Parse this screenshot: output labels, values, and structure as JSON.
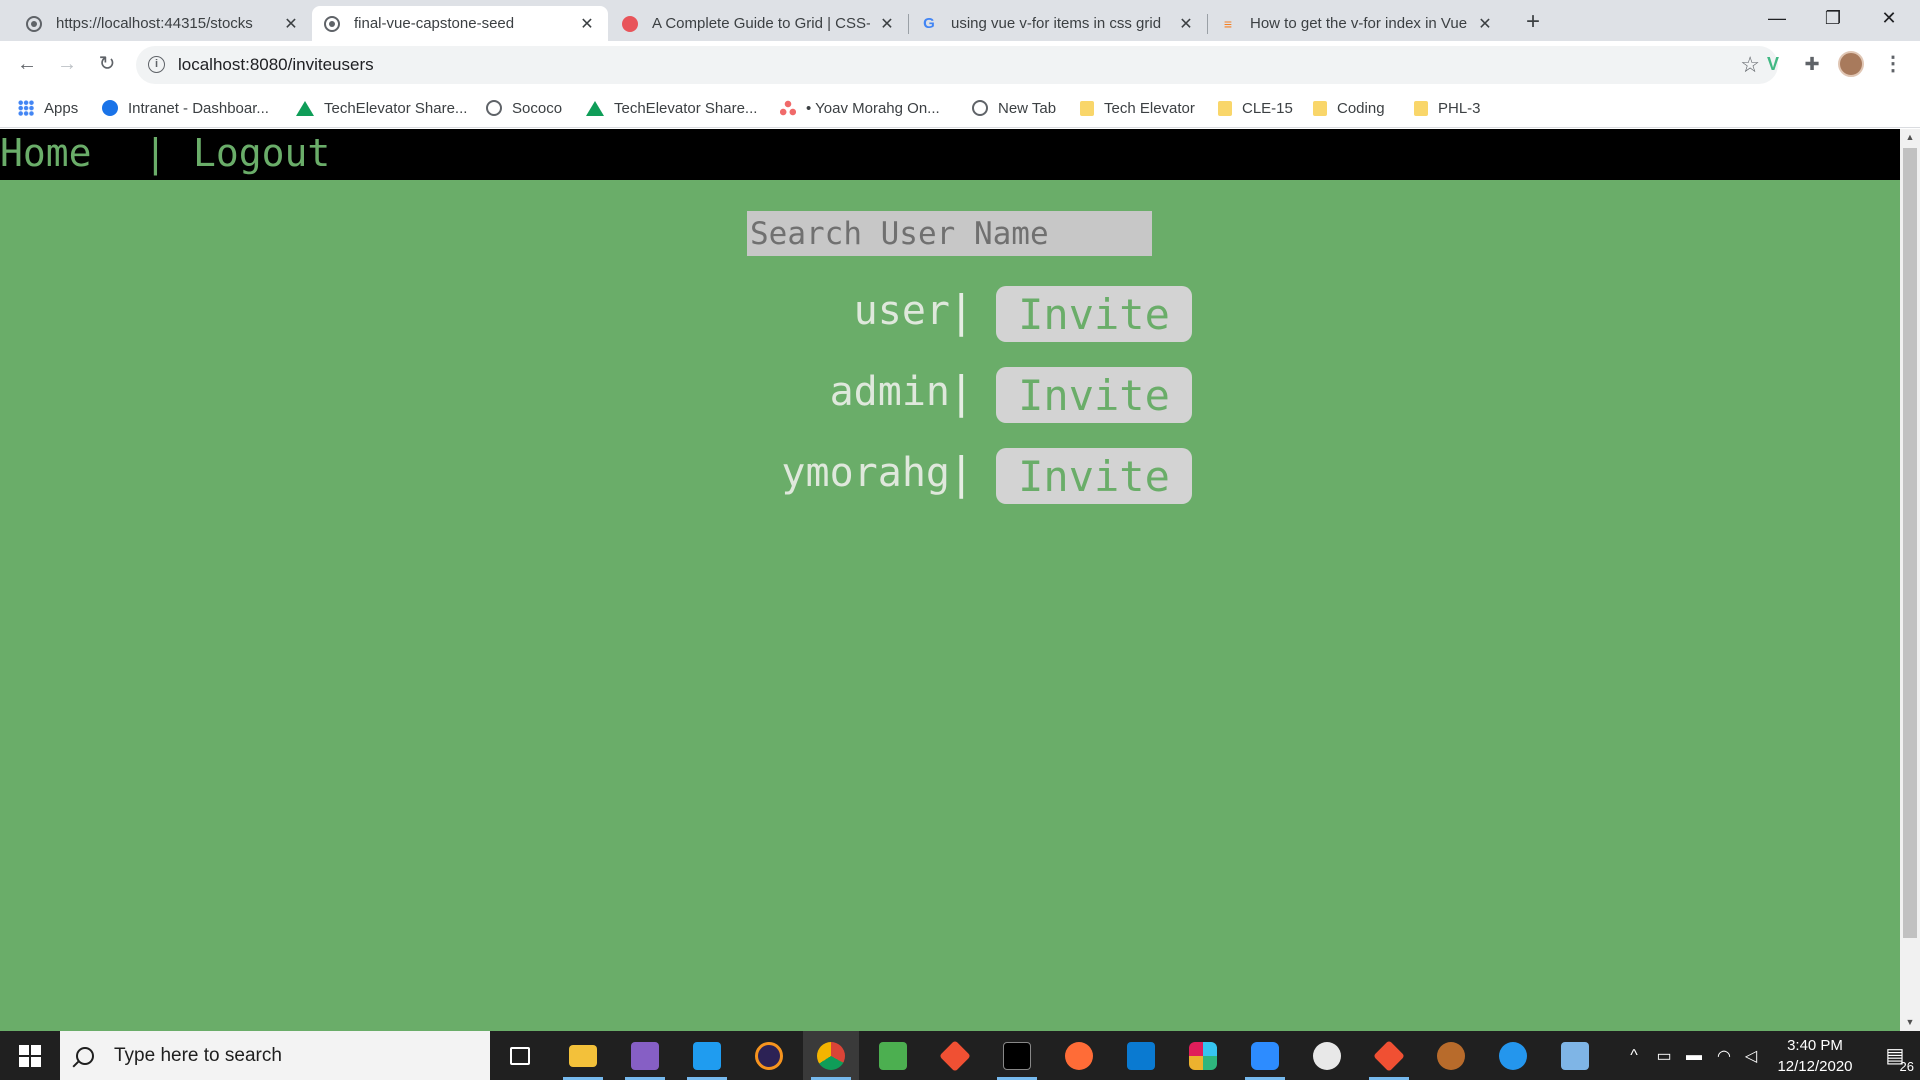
{
  "browser": {
    "tabs": [
      {
        "title": "https://localhost:44315/stocks",
        "icon": "globe-icon"
      },
      {
        "title": "final-vue-capstone-seed",
        "icon": "globe-icon",
        "active": true
      },
      {
        "title": "A Complete Guide to Grid | CSS-T",
        "icon": "css-tricks-icon"
      },
      {
        "title": "using vue v-for items in css grid",
        "icon": "google-icon"
      },
      {
        "title": "How to get the v-for index in Vue",
        "icon": "stackoverflow-icon"
      }
    ],
    "close_glyph": "✕",
    "new_tab_glyph": "+",
    "window_controls": {
      "minimize": "—",
      "maximize": "❐",
      "close": "✕"
    },
    "url": "localhost:8080/inviteusers",
    "nav": {
      "back": "←",
      "forward": "→",
      "reload": "↻",
      "star": "☆",
      "menu": "⋮",
      "puzzle": "✚",
      "vue": "V"
    }
  },
  "bookmarks": [
    {
      "label": "Apps",
      "icon": "apps-icon"
    },
    {
      "label": "Intranet - Dashboar...",
      "icon": "intranet-icon"
    },
    {
      "label": "TechElevator Share...",
      "icon": "google-drive-icon"
    },
    {
      "label": "Sococo",
      "icon": "sococo-icon"
    },
    {
      "label": "TechElevator Share...",
      "icon": "google-drive-icon"
    },
    {
      "label": "• Yoav Morahg On...",
      "icon": "asana-icon"
    },
    {
      "label": "New Tab",
      "icon": "globe-icon"
    },
    {
      "label": "Tech Elevator",
      "icon": "folder-icon"
    },
    {
      "label": "CLE-15",
      "icon": "folder-icon"
    },
    {
      "label": "Coding",
      "icon": "folder-icon"
    },
    {
      "label": "PHL-3",
      "icon": "folder-icon"
    }
  ],
  "app": {
    "nav": {
      "home": "Home",
      "separator": "|",
      "logout": "Logout"
    },
    "search": {
      "placeholder": "Search User Name",
      "value": ""
    },
    "users": [
      {
        "name": "user",
        "separator": "|",
        "action": "Invite"
      },
      {
        "name": "admin",
        "separator": "|",
        "action": "Invite"
      },
      {
        "name": "ymorahg",
        "separator": "|",
        "action": "Invite"
      }
    ],
    "colors": {
      "background": "#6aad69",
      "nav_bar": "#000000",
      "button": "#d3d3d3",
      "input": "#c7c7c7"
    }
  },
  "taskbar": {
    "search_placeholder": "Type here to search",
    "apps": [
      "task-view-icon",
      "file-explorer-icon",
      "visual-studio-icon",
      "vscode-icon",
      "eclipse-icon",
      "chrome-icon",
      "sticky-notes-icon",
      "git-icon",
      "terminal-icon",
      "postman-icon",
      "azure-data-studio-icon",
      "slack-icon",
      "zoom-icon",
      "github-desktop-icon",
      "git-icon",
      "settings-icon",
      "docker-icon",
      "notepad-icon"
    ],
    "tray": {
      "chevron": "^"
    },
    "time": "3:40 PM",
    "date": "12/12/2020",
    "notification_count": "26"
  }
}
